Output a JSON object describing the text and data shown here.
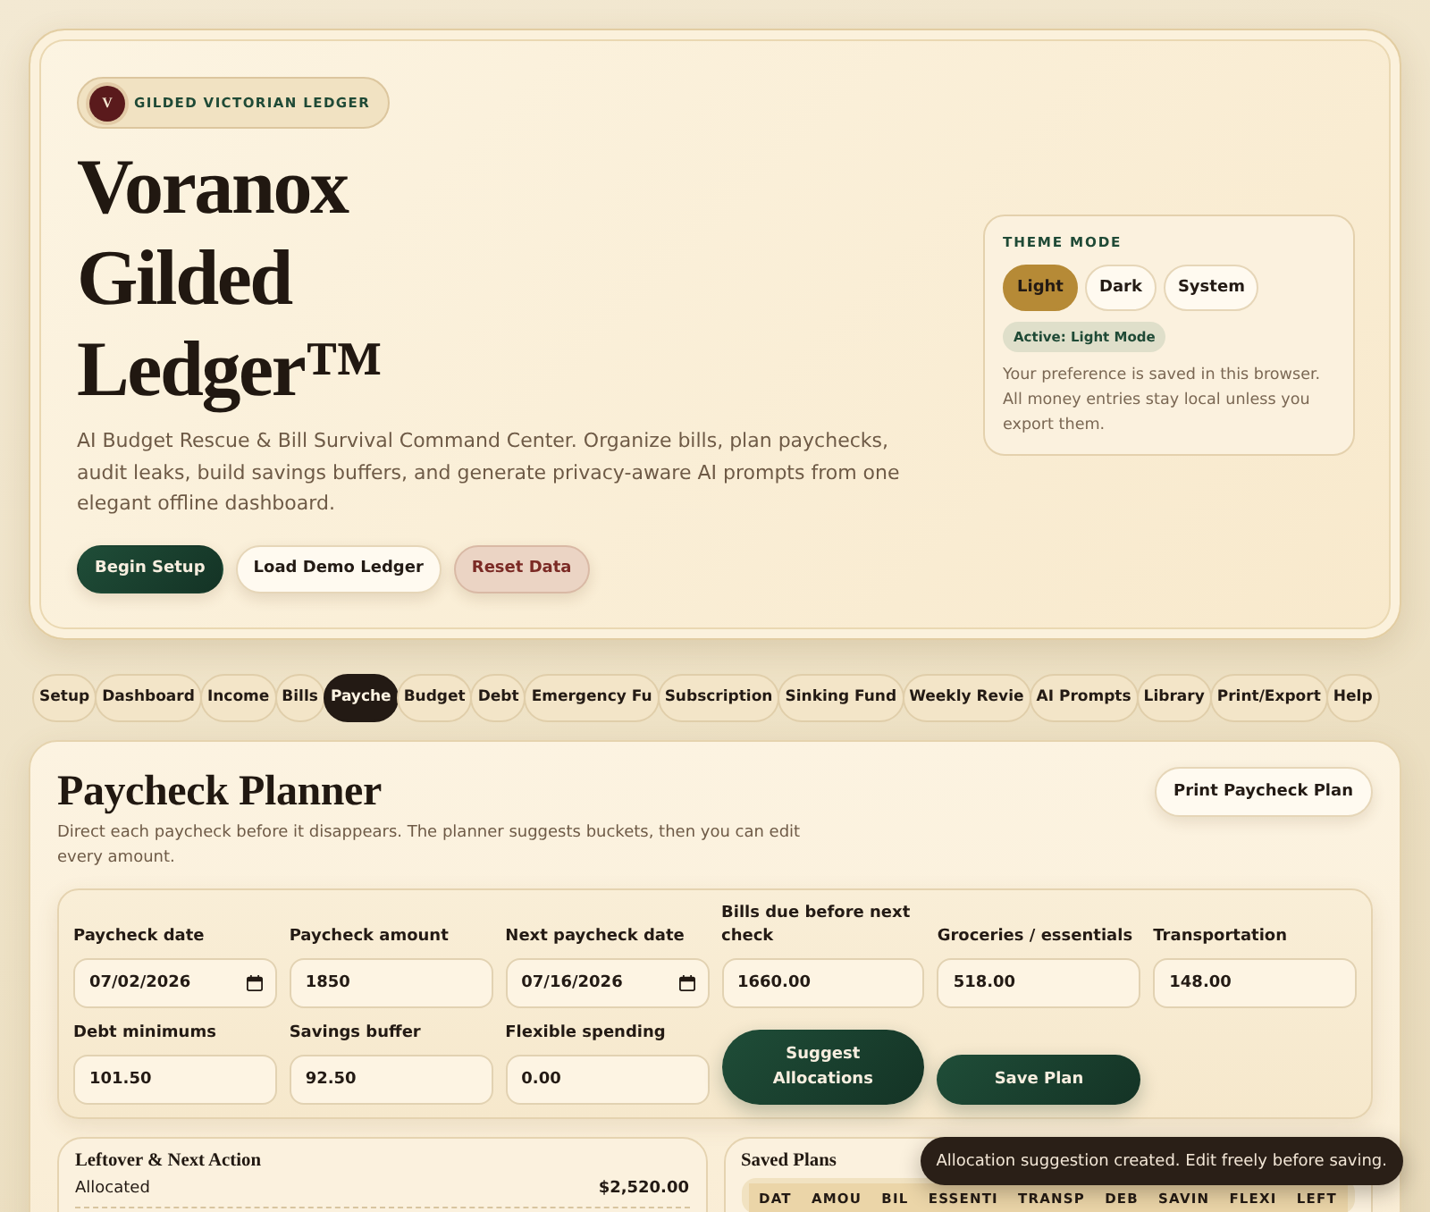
{
  "hero": {
    "badge": {
      "initial": "V",
      "label": "GILDED VICTORIAN LEDGER"
    },
    "title": "Voranox Gilded Ledger™",
    "description": "AI Budget Rescue & Bill Survival Command Center. Organize bills, plan paychecks, audit leaks, build savings buffers, and generate privacy-aware AI prompts from one elegant offline dashboard.",
    "buttons": [
      {
        "label": "Begin Setup",
        "kind": "primary"
      },
      {
        "label": "Load Demo Ledger",
        "kind": "secondary"
      },
      {
        "label": "Reset Data",
        "kind": "danger"
      }
    ]
  },
  "theme": {
    "heading": "THEME MODE",
    "options": [
      {
        "label": "Light",
        "selected": true
      },
      {
        "label": "Dark",
        "selected": false
      },
      {
        "label": "System",
        "selected": false
      }
    ],
    "status": "Active: Light Mode",
    "note": "Your preference is saved in this browser. All money entries stay local unless you export them."
  },
  "tabs": [
    {
      "label": "Setup",
      "selected": false
    },
    {
      "label": "Dashboard",
      "selected": false
    },
    {
      "label": "Income",
      "selected": false
    },
    {
      "label": "Bills",
      "selected": false
    },
    {
      "label": "Payche",
      "selected": true
    },
    {
      "label": "Budget",
      "selected": false
    },
    {
      "label": "Debt",
      "selected": false
    },
    {
      "label": "Emergency Fu",
      "selected": false
    },
    {
      "label": "Subscription",
      "selected": false
    },
    {
      "label": "Sinking Fund",
      "selected": false
    },
    {
      "label": "Weekly Revie",
      "selected": false
    },
    {
      "label": "AI Prompts",
      "selected": false
    },
    {
      "label": "Library",
      "selected": false
    },
    {
      "label": "Print/Export",
      "selected": false
    },
    {
      "label": "Help",
      "selected": false
    }
  ],
  "planner": {
    "title": "Paycheck Planner",
    "subtitle": "Direct each paycheck before it disappears. The planner suggests buckets, then you can edit every amount.",
    "print_button": "Print Paycheck Plan",
    "fields": [
      {
        "label": "Paycheck date",
        "value": "07/02/2026",
        "kind": "date"
      },
      {
        "label": "Paycheck amount",
        "value": "1850",
        "kind": "text"
      },
      {
        "label": "Next paycheck date",
        "value": "07/16/2026",
        "kind": "date"
      },
      {
        "label": "Bills due before next check",
        "value": "1660.00",
        "kind": "text"
      },
      {
        "label": "Groceries / essentials",
        "value": "518.00",
        "kind": "text"
      },
      {
        "label": "Transportation",
        "value": "148.00",
        "kind": "text"
      },
      {
        "label": "Debt minimums",
        "value": "101.50",
        "kind": "text"
      },
      {
        "label": "Savings buffer",
        "value": "92.50",
        "kind": "text"
      },
      {
        "label": "Flexible spending",
        "value": "0.00",
        "kind": "text"
      }
    ],
    "actions": [
      {
        "label": "Suggest Allocations",
        "kind": "tall"
      },
      {
        "label": "Save Plan",
        "kind": "short"
      }
    ]
  },
  "leftover": {
    "title": "Leftover & Next Action",
    "rows": [
      {
        "label": "Allocated",
        "value": "$2,520.00"
      }
    ]
  },
  "saved_plans": {
    "title": "Saved Plans",
    "columns": [
      "DAT",
      "AMOU",
      "BIL",
      "ESSENTI",
      "TRANSP",
      "DEB",
      "SAVIN",
      "FLEXI",
      "LEFT"
    ]
  },
  "toast": "Allocation suggestion created. Edit freely before saving."
}
